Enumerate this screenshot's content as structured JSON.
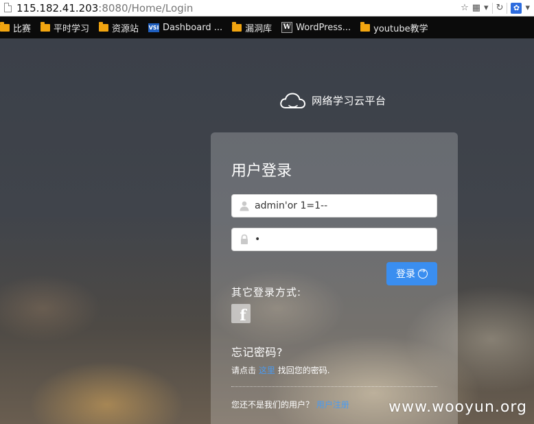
{
  "browser": {
    "url_host": "115.182.41.203",
    "url_path": ":8080/Home/Login",
    "bookmarks": [
      {
        "label": "比赛",
        "icon": "folder-icon"
      },
      {
        "label": "平时学习",
        "icon": "folder-icon"
      },
      {
        "label": "资源站",
        "icon": "folder-icon"
      },
      {
        "label": "Dashboard ...",
        "icon": "vsi-icon"
      },
      {
        "label": "漏洞库",
        "icon": "folder-icon"
      },
      {
        "label": "WordPress...",
        "icon": "wordpress-icon"
      },
      {
        "label": "youtube教学",
        "icon": "folder-icon"
      }
    ],
    "vsi_glyph": "VSI",
    "wp_glyph": "W"
  },
  "brand": {
    "name": "网络学习云平台"
  },
  "login": {
    "title": "用户登录",
    "username_value": "admin'or 1=1--",
    "password_value": "•",
    "submit_label": "登录"
  },
  "other_login": {
    "title": "其它登录方式:",
    "facebook_glyph": "f"
  },
  "forgot": {
    "title": "忘记密码?",
    "prefix": "请点击",
    "link": "这里",
    "suffix": "找回您的密码."
  },
  "register": {
    "prefix": "您还不是我们的用户？",
    "link": "用户注册"
  },
  "watermark": "www.wooyun.org",
  "colors": {
    "accent": "#3a8ef0",
    "link": "#4a9bf0",
    "bookmark_bar": "#0b0b0b"
  }
}
